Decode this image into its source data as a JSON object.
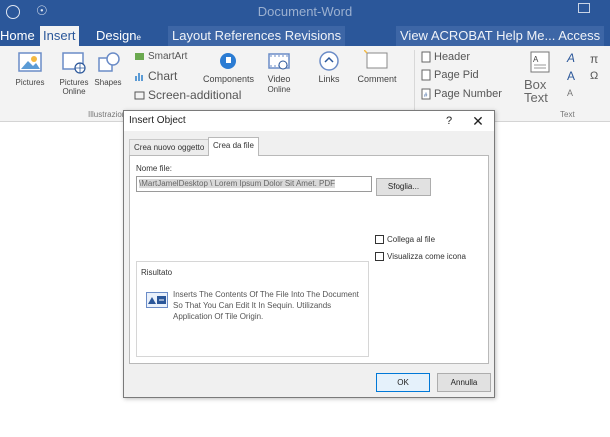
{
  "window": {
    "title": "Document-Word"
  },
  "tabs": {
    "home": "Home",
    "insert": "Insert",
    "design": "Design",
    "design_suffix": "e",
    "middle": "Layout References Revisions",
    "right": "View ACROBAT Help Me... Access"
  },
  "ribbon": {
    "pictures": "Pictures",
    "online_pictures": "Pictures",
    "online_pictures_sub": "Online",
    "shapes": "Shapes",
    "smartart": "SmartArt",
    "chart": "Chart",
    "screen": "Screen-additional",
    "components": "Components",
    "video": "Video",
    "video_sub": "Online",
    "links": "Links",
    "comment": "Comment",
    "header": "Header",
    "page_foot": "Page Pid",
    "page_number": "Page Number",
    "box": "Box",
    "text": "Text",
    "group_illustrations": "Illustrazioni",
    "group_text": "Text"
  },
  "dialog": {
    "title": "Insert Object",
    "help": "?",
    "close": "✕",
    "tab_new": "Crea nuovo oggetto",
    "tab_file": "Crea da file",
    "file_label": "Nome file:",
    "file_value": "\\MartJamelDesktop \\ Lorem Ipsum Dolor Sit Amet. PDF",
    "browse": "Sfoglia...",
    "link_label": "Collega al file",
    "icon_label": "Visualizza come icona",
    "result_title": "Risultato",
    "result_text": "Inserts The Contents Of The File Into The Document So That You Can Edit It In Sequin. Utilizands Application Of Tile Origin.",
    "ok": "OK",
    "cancel": "Annulla"
  },
  "colors": {
    "titlebar": "#2b579a",
    "ribbon_bg": "#f3f3f3",
    "dialog_bg": "#f0f0f0",
    "ok_border": "#0078d7"
  }
}
